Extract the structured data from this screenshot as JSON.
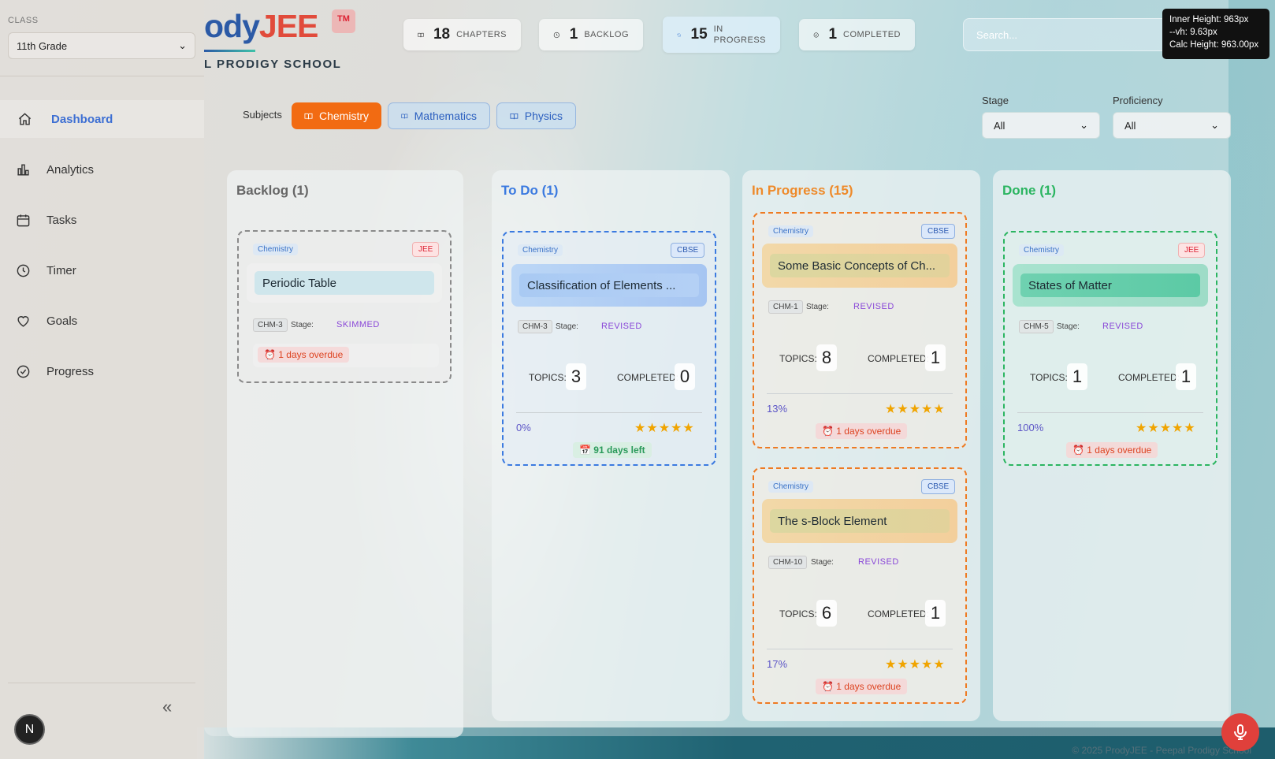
{
  "sidebar": {
    "class_label": "CLASS",
    "class_value": "11th Grade",
    "items": [
      {
        "label": "Dashboard"
      },
      {
        "label": "Analytics"
      },
      {
        "label": "Tasks"
      },
      {
        "label": "Timer"
      },
      {
        "label": "Goals"
      },
      {
        "label": "Progress"
      }
    ],
    "collapse_icon": "«",
    "avatar_initial": "N"
  },
  "brand": {
    "logo_part1": "ody",
    "logo_part2": "JEE",
    "tm": "TM",
    "school": "L PRODIGY SCHOOL"
  },
  "stats": [
    {
      "value": "18",
      "label": "CHAPTERS"
    },
    {
      "value": "1",
      "label": "BACKLOG"
    },
    {
      "value": "15",
      "label_line1": "IN",
      "label_line2": "PROGRESS"
    },
    {
      "value": "1",
      "label": "COMPLETED"
    }
  ],
  "search": {
    "placeholder": "Search..."
  },
  "debug": {
    "line1": "Inner Height: 963px",
    "line2": "--vh: 9.63px",
    "line3": "Calc Height: 963.00px"
  },
  "subjects": {
    "label": "Subjects",
    "tabs": [
      {
        "label": "Chemistry",
        "active": true
      },
      {
        "label": "Mathematics",
        "active": false
      },
      {
        "label": "Physics",
        "active": false
      }
    ]
  },
  "filters": {
    "stage_label": "Stage",
    "stage_value": "All",
    "proficiency_label": "Proficiency",
    "proficiency_value": "All"
  },
  "columns": {
    "backlog": {
      "title": "Backlog (1)",
      "cards": [
        {
          "subject": "Chemistry",
          "tag": "JEE",
          "title": "Periodic Table",
          "code": "CHM-3",
          "stage_label": "Stage:",
          "stage": "SKIMMED",
          "due": "1 days overdue"
        }
      ]
    },
    "todo": {
      "title": "To Do (1)",
      "cards": [
        {
          "subject": "Chemistry",
          "tag": "CBSE",
          "title": "Classification of Elements ...",
          "code": "CHM-3",
          "stage_label": "Stage:",
          "stage": "REVISED",
          "topics_label": "TOPICS:",
          "topics": "3",
          "completed_label": "COMPLETED:",
          "completed": "0",
          "percent": "0%",
          "stars": "★★★★★",
          "due": "91 days left"
        }
      ]
    },
    "inprogress": {
      "title": "In Progress (15)",
      "cards": [
        {
          "subject": "Chemistry",
          "tag": "CBSE",
          "title": "Some Basic Concepts of Ch...",
          "code": "CHM-1",
          "stage_label": "Stage:",
          "stage": "REVISED",
          "topics_label": "TOPICS:",
          "topics": "8",
          "completed_label": "COMPLETED:",
          "completed": "1",
          "percent": "13%",
          "stars": "★★★★★",
          "due": "1 days overdue"
        },
        {
          "subject": "Chemistry",
          "tag": "CBSE",
          "title": "The s-Block Element",
          "code": "CHM-10",
          "stage_label": "Stage:",
          "stage": "REVISED",
          "topics_label": "TOPICS:",
          "topics": "6",
          "completed_label": "COMPLETED:",
          "completed": "1",
          "percent": "17%",
          "stars": "★★★★★",
          "due": "1 days overdue"
        }
      ]
    },
    "done": {
      "title": "Done (1)",
      "cards": [
        {
          "subject": "Chemistry",
          "tag": "JEE",
          "title": "States of Matter",
          "code": "CHM-5",
          "stage_label": "Stage:",
          "stage": "REVISED",
          "topics_label": "TOPICS:",
          "topics": "1",
          "completed_label": "COMPLETED:",
          "completed": "1",
          "percent": "100%",
          "stars": "★★★★★",
          "due": "1 days overdue"
        }
      ]
    }
  },
  "footer": "© 2025 ProdyJEE - Peepal Prodigy School",
  "colors": {
    "accent": "#f26b12",
    "todo": "#3b7ae0",
    "inprogress": "#ee7a22",
    "done": "#2bb561",
    "backlog": "#888888"
  }
}
